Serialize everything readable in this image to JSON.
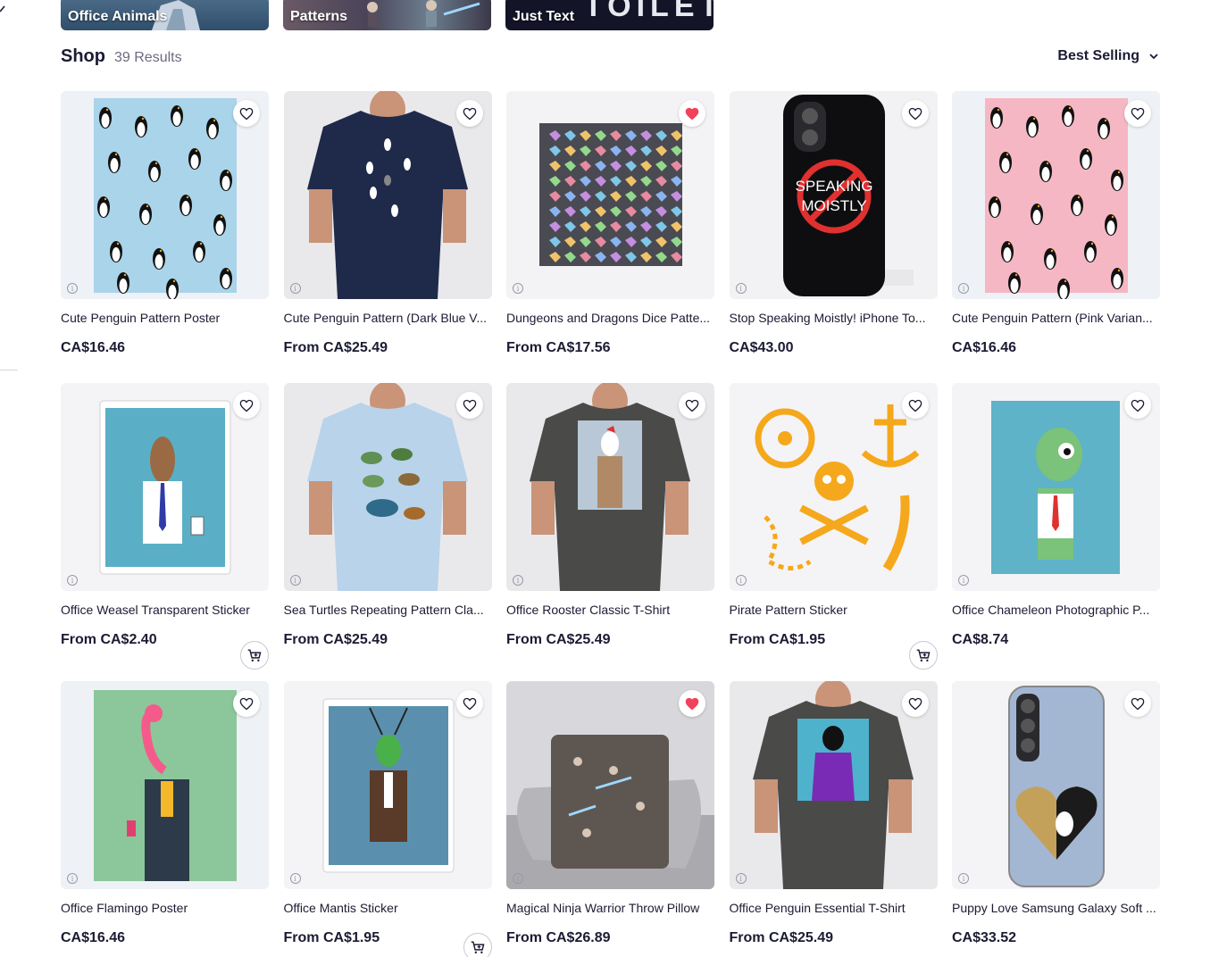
{
  "collections": [
    {
      "label": "Office Animals"
    },
    {
      "label": "Patterns"
    },
    {
      "label": "Just Text",
      "art_text": "TOILET"
    }
  ],
  "shop": {
    "title": "Shop",
    "results": "39 Results"
  },
  "sort": {
    "label": "Best Selling"
  },
  "products": [
    {
      "title": "Cute Penguin Pattern Poster",
      "price": "CA$16.46",
      "favorited": false,
      "cart": false
    },
    {
      "title": "Cute Penguin Pattern (Dark Blue V...",
      "price": "From CA$25.49",
      "favorited": false,
      "cart": false
    },
    {
      "title": "Dungeons and Dragons Dice Patte...",
      "price": "From CA$17.56",
      "favorited": true,
      "cart": false
    },
    {
      "title": "Stop Speaking Moistly! iPhone To...",
      "price": "CA$43.00",
      "favorited": false,
      "cart": false,
      "art_text": "SPEAKING MOISTLY"
    },
    {
      "title": "Cute Penguin Pattern (Pink Varian...",
      "price": "CA$16.46",
      "favorited": false,
      "cart": false
    },
    {
      "title": "Office Weasel Transparent Sticker",
      "price": "From CA$2.40",
      "favorited": false,
      "cart": true
    },
    {
      "title": "Sea Turtles Repeating Pattern Cla...",
      "price": "From CA$25.49",
      "favorited": false,
      "cart": false
    },
    {
      "title": "Office Rooster Classic T-Shirt",
      "price": "From CA$25.49",
      "favorited": false,
      "cart": false
    },
    {
      "title": "Pirate Pattern Sticker",
      "price": "From CA$1.95",
      "favorited": false,
      "cart": true
    },
    {
      "title": "Office Chameleon Photographic P...",
      "price": "CA$8.74",
      "favorited": false,
      "cart": false
    },
    {
      "title": "Office Flamingo Poster",
      "price": "CA$16.46",
      "favorited": false,
      "cart": false
    },
    {
      "title": "Office Mantis Sticker",
      "price": "From CA$1.95",
      "favorited": false,
      "cart": true
    },
    {
      "title": "Magical Ninja Warrior Throw Pillow",
      "price": "From CA$26.89",
      "favorited": true,
      "cart": false
    },
    {
      "title": "Office Penguin Essential T-Shirt",
      "price": "From CA$25.49",
      "favorited": false,
      "cart": false
    },
    {
      "title": "Puppy Love Samsung Galaxy Soft ...",
      "price": "CA$33.52",
      "favorited": false,
      "cart": false
    }
  ],
  "icons": {
    "favorite": "heart-outline-icon",
    "favorite_active": "heart-filled-icon",
    "info": "info-icon",
    "cart": "add-to-cart-icon",
    "sort": "chevron-down-icon"
  },
  "colors": {
    "text": "#1b1b33",
    "muted": "#6a6a82",
    "heart_active": "#f2415a",
    "card_bg": "#f4f4f6"
  }
}
